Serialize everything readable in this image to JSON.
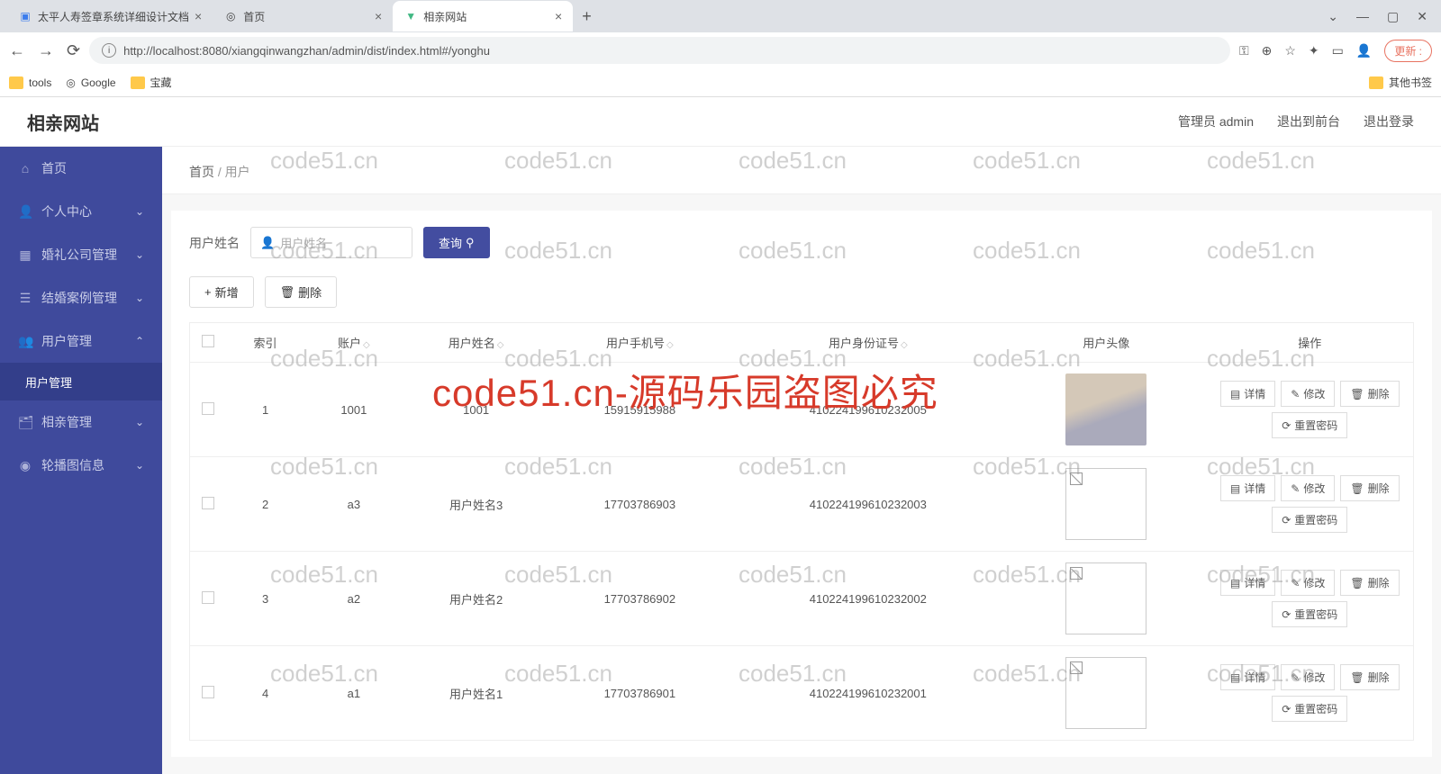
{
  "browser": {
    "tabs": [
      {
        "title": "太平人寿签章系统详细设计文档"
      },
      {
        "title": "首页"
      },
      {
        "title": "相亲网站"
      }
    ],
    "url": "http://localhost:8080/xiangqinwangzhan/admin/dist/index.html#/yonghu",
    "update": "更新",
    "bookmarks": {
      "tools": "tools",
      "google": "Google",
      "baozang": "宝藏",
      "other": "其他书签"
    },
    "win": {
      "min": "—",
      "max": "▢",
      "close": "✕",
      "dd": "⌄"
    }
  },
  "app": {
    "title": "相亲网站",
    "admin": "管理员 admin",
    "toFront": "退出到前台",
    "logout": "退出登录"
  },
  "sidebar": {
    "items": [
      {
        "icon": "⌂",
        "label": "首页"
      },
      {
        "icon": "👤",
        "label": "个人中心",
        "chev": "⌄"
      },
      {
        "icon": "▦",
        "label": "婚礼公司管理",
        "chev": "⌄"
      },
      {
        "icon": "☰",
        "label": "结婚案例管理",
        "chev": "⌄"
      },
      {
        "icon": "👥",
        "label": "用户管理",
        "chev": "⌃",
        "open": true
      },
      {
        "icon": "",
        "label": "用户管理",
        "sub": true
      },
      {
        "icon": "🗂",
        "label": "相亲管理",
        "chev": "⌄"
      },
      {
        "icon": "◉",
        "label": "轮播图信息",
        "chev": "⌄"
      }
    ]
  },
  "crumbs": {
    "home": "首页",
    "sep": "/",
    "current": "用户"
  },
  "filter": {
    "label": "用户姓名",
    "placeholder": "用户姓名",
    "search": "查询"
  },
  "actions": {
    "add": "新增",
    "del": "删除"
  },
  "table": {
    "headers": [
      "索引",
      "账户",
      "用户姓名",
      "用户手机号",
      "用户身份证号",
      "用户头像",
      "操作"
    ],
    "ops": {
      "detail": "详情",
      "edit": "修改",
      "del": "删除",
      "reset": "重置密码"
    },
    "rows": [
      {
        "idx": "1",
        "acct": "1001",
        "name": "1001",
        "phone": "15915915988",
        "idno": "410224199610232005",
        "avatar": "img"
      },
      {
        "idx": "2",
        "acct": "a3",
        "name": "用户姓名3",
        "phone": "17703786903",
        "idno": "410224199610232003",
        "avatar": "broken"
      },
      {
        "idx": "3",
        "acct": "a2",
        "name": "用户姓名2",
        "phone": "17703786902",
        "idno": "410224199610232002",
        "avatar": "broken"
      },
      {
        "idx": "4",
        "acct": "a1",
        "name": "用户姓名1",
        "phone": "17703786901",
        "idno": "410224199610232001",
        "avatar": "broken"
      }
    ]
  },
  "watermark": {
    "text": "code51.cn",
    "red": "code51.cn-源码乐园盗图必究"
  }
}
